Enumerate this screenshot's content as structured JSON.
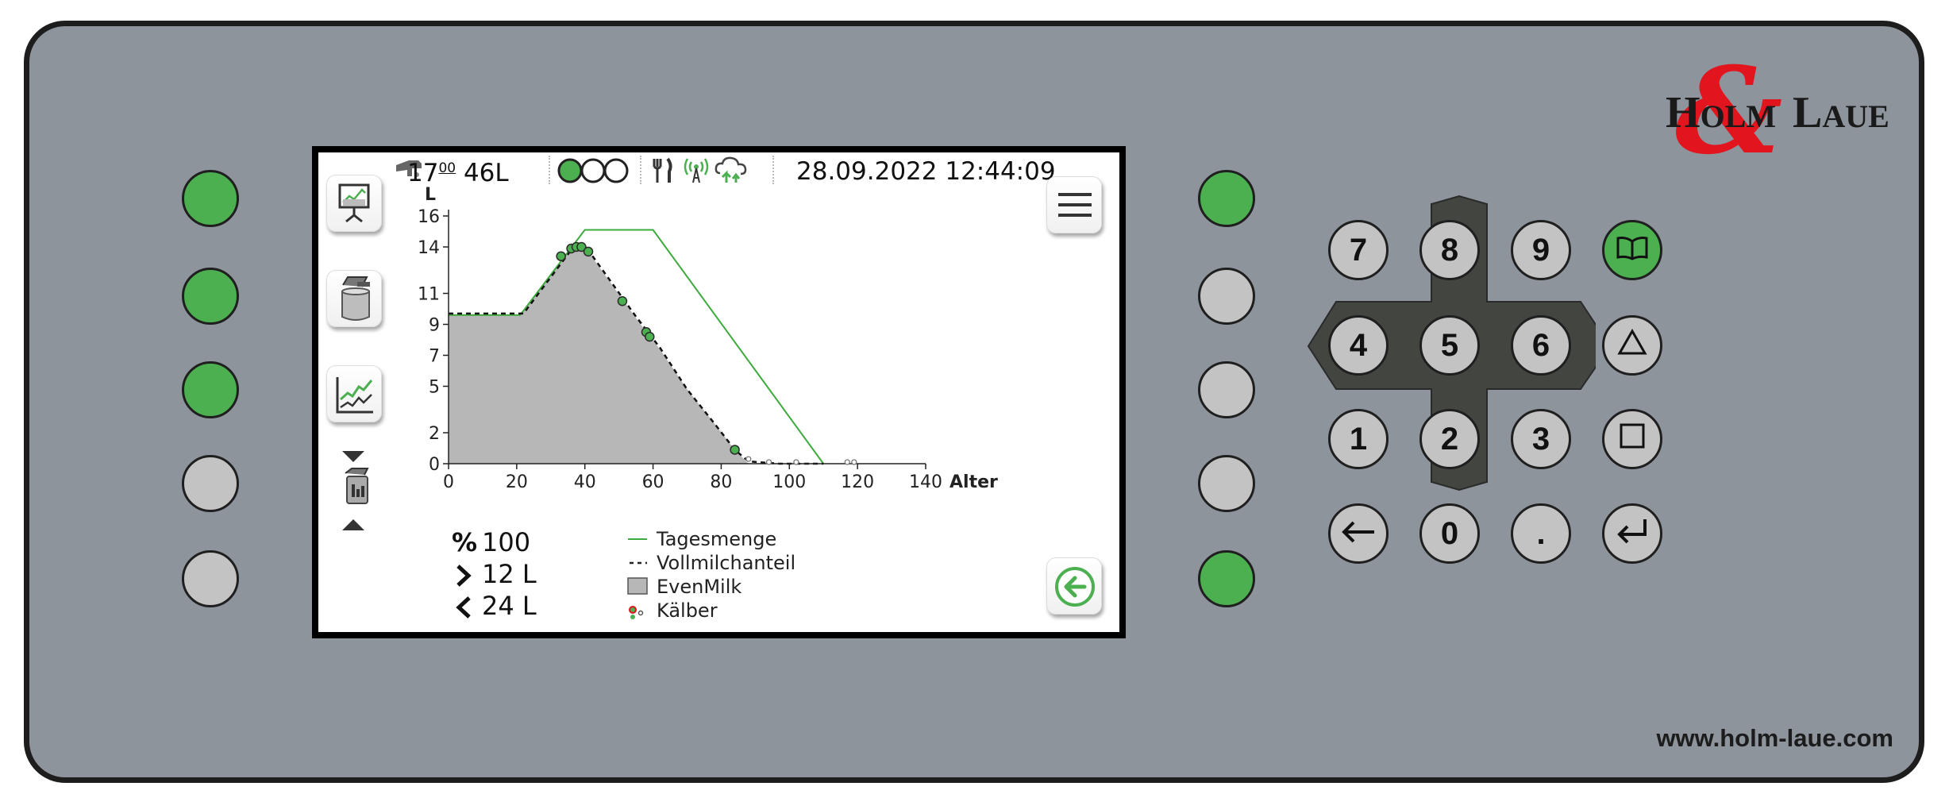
{
  "brand": {
    "logo_text": "HOLM & LAUE",
    "website": "www.holm-laue.com",
    "accent_green": "#4caf50",
    "logo_red": "#e2141e"
  },
  "status_bar": {
    "volume_main": "17",
    "volume_sup": "00",
    "volume_liters": "46L",
    "datetime": "28.09.2022 12:44:09",
    "icons": [
      "milk-dispenser-icon",
      "three-status-circles-icon",
      "fork-knife-icon",
      "wireless-signal-icon",
      "cloud-sync-icon"
    ]
  },
  "sidebar": {
    "items": [
      {
        "name": "presentation-chart-icon"
      },
      {
        "name": "milk-tank-icon"
      },
      {
        "name": "line-chart-icon"
      },
      {
        "name": "tank-selector-icon"
      }
    ]
  },
  "chart_data": {
    "type": "line",
    "ylabel": "L",
    "xlabel": "Alter",
    "xlim": [
      0,
      140
    ],
    "ylim": [
      0,
      16
    ],
    "xticks": [
      0,
      20,
      40,
      60,
      80,
      100,
      120,
      140
    ],
    "yticks": [
      0,
      2,
      5,
      7,
      9,
      11,
      14,
      16
    ],
    "series": [
      {
        "name": "Tagesmenge",
        "color": "#3daa3d",
        "points": [
          [
            0,
            9.6
          ],
          [
            21,
            9.6
          ],
          [
            40,
            15.1
          ],
          [
            60,
            15.1
          ],
          [
            110,
            0
          ]
        ]
      },
      {
        "name": "Vollmilchanteil",
        "style": "dashed",
        "points": [
          [
            0,
            9.7
          ],
          [
            22,
            9.7
          ],
          [
            37,
            14.1
          ],
          [
            40,
            14.1
          ],
          [
            55,
            9.5
          ],
          [
            62,
            7.5
          ],
          [
            70,
            4.8
          ],
          [
            78,
            2.6
          ],
          [
            84,
            0.9
          ],
          [
            88,
            0.15
          ],
          [
            97,
            0
          ],
          [
            110,
            0
          ]
        ]
      },
      {
        "name": "EvenMilk",
        "style": "area",
        "color": "#b7b7b7",
        "points": [
          [
            0,
            9.6
          ],
          [
            21,
            9.6
          ],
          [
            37,
            14.2
          ],
          [
            40,
            14.0
          ],
          [
            55,
            9.4
          ],
          [
            62,
            7.4
          ],
          [
            70,
            4.8
          ],
          [
            78,
            2.6
          ],
          [
            84,
            0.9
          ],
          [
            88,
            0
          ],
          [
            0,
            0
          ]
        ]
      },
      {
        "name": "Kälber",
        "style": "markers",
        "points": [
          [
            33,
            13.4
          ],
          [
            36,
            13.9
          ],
          [
            37.5,
            14.0
          ],
          [
            39,
            14.0
          ],
          [
            41,
            13.7
          ],
          [
            51,
            10.5
          ],
          [
            58,
            8.5
          ],
          [
            59,
            8.2
          ],
          [
            84,
            0.9
          ]
        ],
        "empty_points": [
          [
            88,
            0.2
          ],
          [
            94,
            0
          ],
          [
            102,
            0
          ],
          [
            117,
            0
          ],
          [
            119,
            0
          ]
        ]
      }
    ]
  },
  "stats": {
    "percent_symbol": "%",
    "percent_value": "100",
    "gt_value": "12 L",
    "lt_value": "24 L"
  },
  "keypad": {
    "keys": [
      "7",
      "8",
      "9",
      "4",
      "5",
      "6",
      "1",
      "2",
      "3",
      "0",
      "."
    ]
  }
}
